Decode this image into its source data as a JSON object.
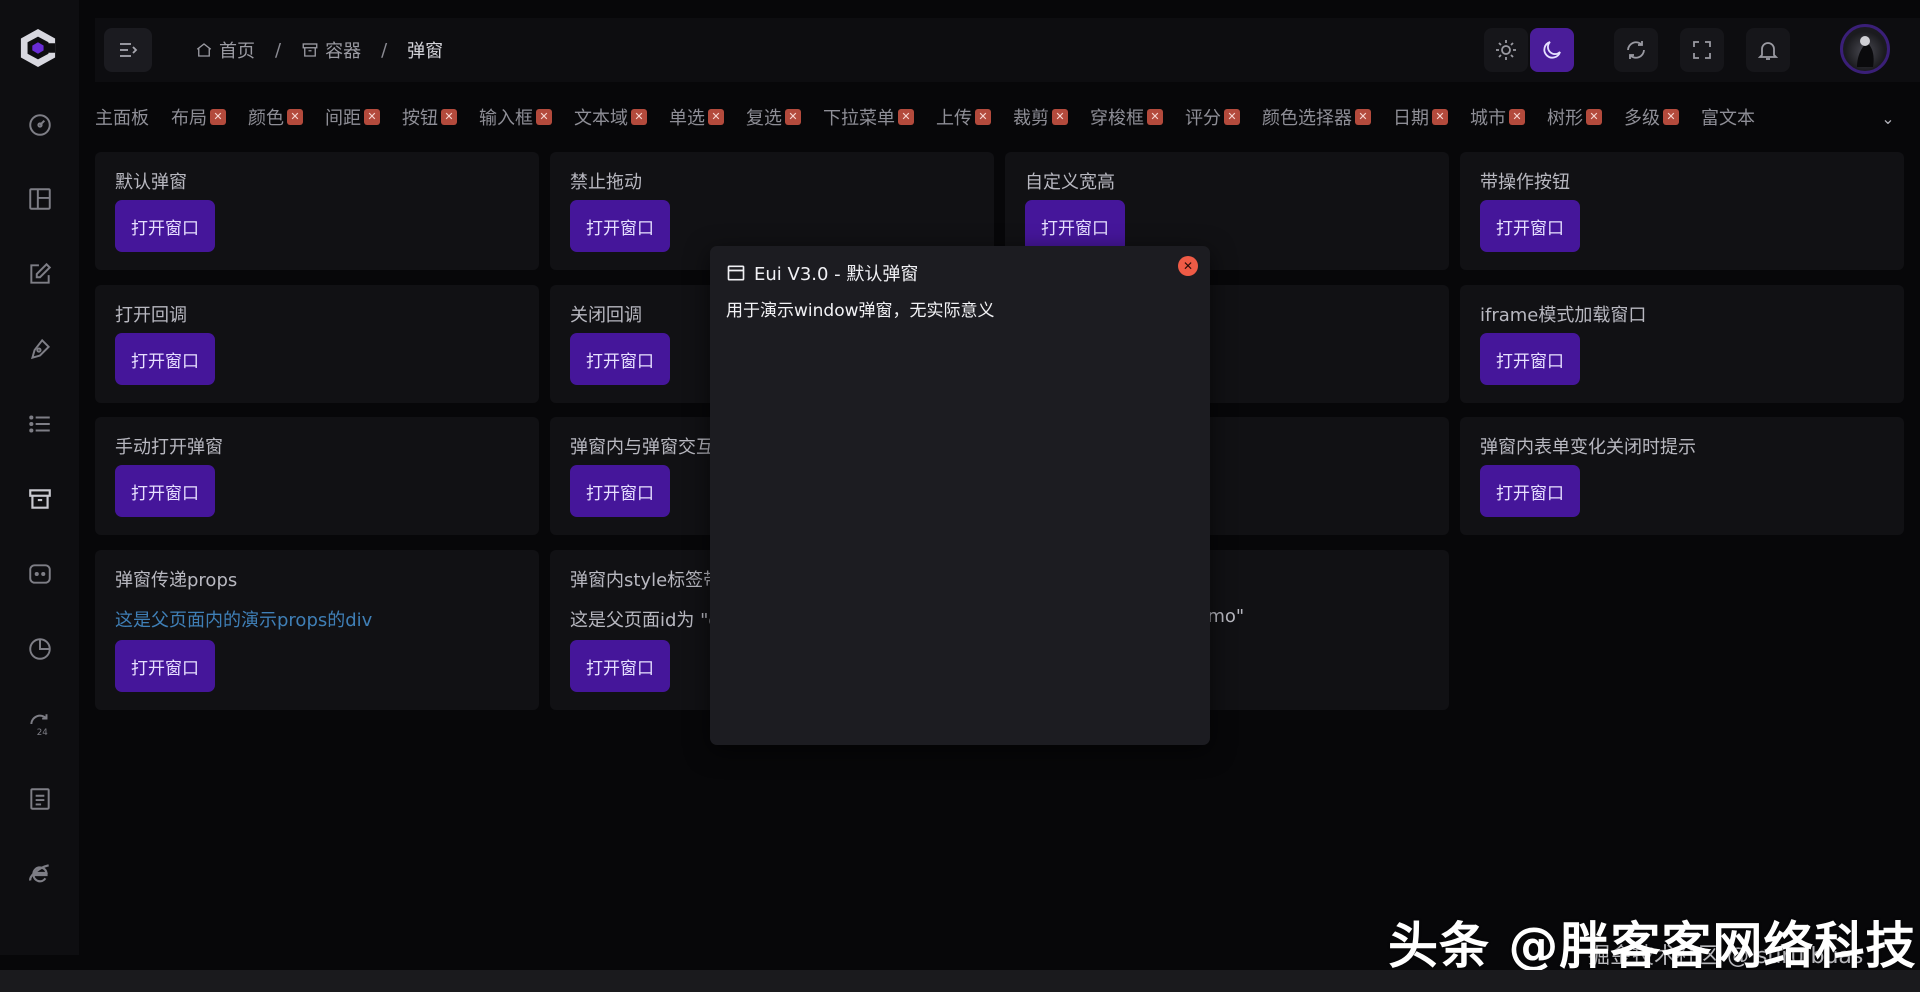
{
  "header": {
    "breadcrumb": [
      {
        "label": "首页",
        "icon": "home-icon"
      },
      {
        "label": "容器",
        "icon": "archive-icon"
      },
      {
        "label": "弹窗"
      }
    ],
    "separator": "/"
  },
  "sidebar": {
    "items": [
      {
        "icon": "dashboard-icon"
      },
      {
        "icon": "layout-icon"
      },
      {
        "icon": "edit-icon"
      },
      {
        "icon": "pen-tool-icon"
      },
      {
        "icon": "list-icon"
      },
      {
        "icon": "archive-icon",
        "active": true
      },
      {
        "icon": "chat-icon"
      },
      {
        "icon": "pie-chart-icon"
      },
      {
        "icon": "refresh-24-icon"
      },
      {
        "icon": "document-icon"
      },
      {
        "icon": "ie-icon"
      }
    ]
  },
  "tabs": [
    {
      "label": "主面板",
      "closable": false
    },
    {
      "label": "布局",
      "closable": true
    },
    {
      "label": "颜色",
      "closable": true
    },
    {
      "label": "间距",
      "closable": true
    },
    {
      "label": "按钮",
      "closable": true
    },
    {
      "label": "输入框",
      "closable": true
    },
    {
      "label": "文本域",
      "closable": true
    },
    {
      "label": "单选",
      "closable": true
    },
    {
      "label": "复选",
      "closable": true
    },
    {
      "label": "下拉菜单",
      "closable": true
    },
    {
      "label": "上传",
      "closable": true
    },
    {
      "label": "裁剪",
      "closable": true
    },
    {
      "label": "穿梭框",
      "closable": true
    },
    {
      "label": "评分",
      "closable": true
    },
    {
      "label": "颜色选择器",
      "closable": true
    },
    {
      "label": "日期",
      "closable": true
    },
    {
      "label": "城市",
      "closable": true
    },
    {
      "label": "树形",
      "closable": true
    },
    {
      "label": "多级",
      "closable": true
    },
    {
      "label": "富文本",
      "closable": false
    }
  ],
  "tab_close_symbol": "✕",
  "tabs_more_symbol": "⌄",
  "cards": [
    {
      "title": "默认弹窗",
      "button": "打开窗口"
    },
    {
      "title": "禁止拖动",
      "button": "打开窗口"
    },
    {
      "title": "自定义宽高",
      "button": "打开窗口"
    },
    {
      "title": "带操作按钮",
      "button": "打开窗口"
    },
    {
      "title": "打开回调",
      "button": "打开窗口"
    },
    {
      "title": "关闭回调",
      "button": "打开窗口"
    },
    {
      "title": "iframe模式加载窗口",
      "button": "打开窗口"
    },
    {
      "title": "手动打开弹窗",
      "button": "打开窗口"
    },
    {
      "title": "弹窗内与弹窗交互",
      "button": "打开窗口"
    },
    {
      "title": "弹窗内表单变化关闭时提示",
      "button": "打开窗口"
    },
    {
      "title": "弹窗传递props",
      "text": "这是父页面内的演示props的div",
      "button": "打开窗口"
    },
    {
      "title": "弹窗内style标签带",
      "text": "这是父页面id为 \"d",
      "button": "打开窗口"
    },
    {
      "text": "hDemo\""
    }
  ],
  "modal": {
    "title": "Eui V3.0 - 默认弹窗",
    "body": "用于演示window弹窗，无实际意义",
    "close_symbol": "✕"
  },
  "watermark": {
    "main": "头条 @胖客客网络科技",
    "sub": "掘金技术社区 @ suruibuas"
  },
  "colors": {
    "accent": "#45169a",
    "link": "#3f7fb6",
    "close": "#ef5b46"
  }
}
